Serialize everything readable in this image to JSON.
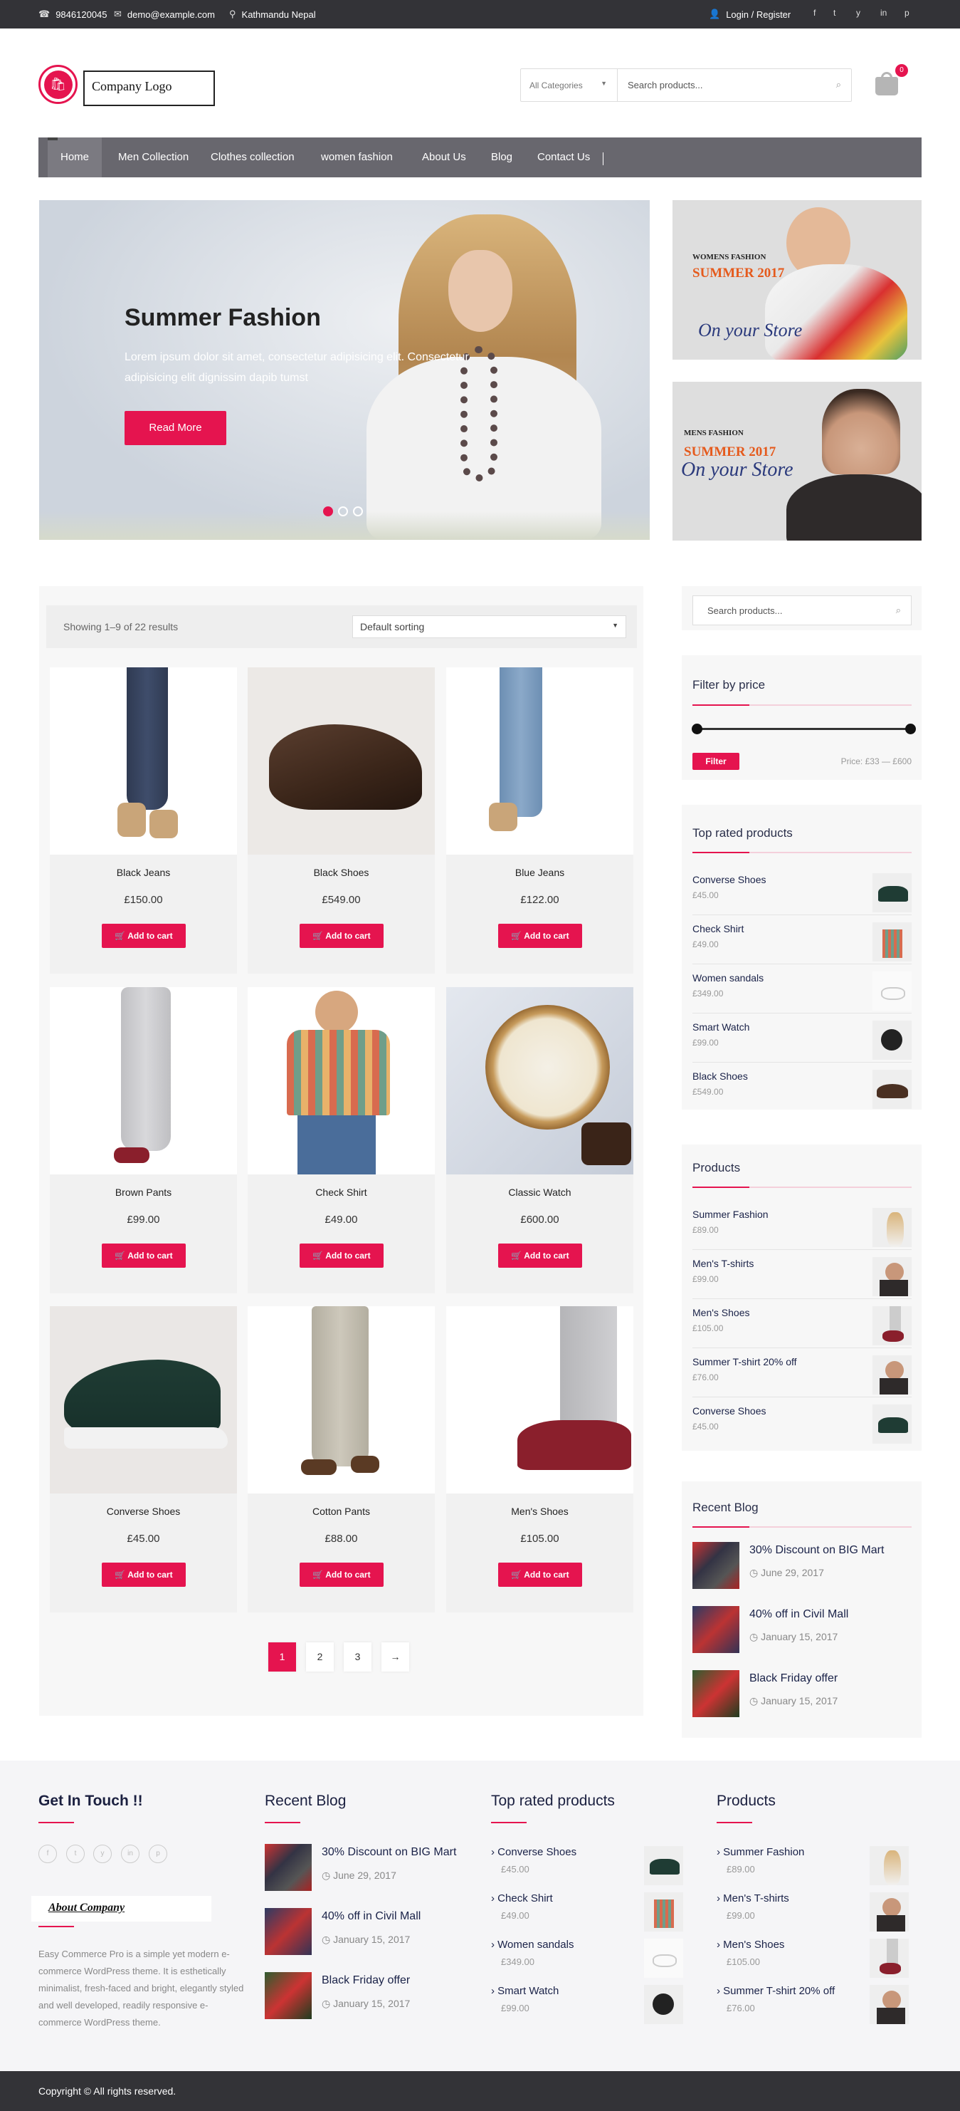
{
  "topbar": {
    "phone": "9846120045",
    "email": "demo@example.com",
    "location": "Kathmandu Nepal",
    "login": "Login / Register",
    "social": [
      "f",
      "t",
      "y",
      "in",
      "p"
    ]
  },
  "header": {
    "logo_text": "Company Logo",
    "category": "All Categories",
    "search_placeholder": "Search products...",
    "cart_count": "0"
  },
  "nav": {
    "items": [
      "Home",
      "Men Collection",
      "Clothes collection",
      "women fashion",
      "About Us",
      "Blog",
      "Contact Us"
    ]
  },
  "hero": {
    "title": "Summer Fashion",
    "text": "Lorem ipsum dolor sit amet, consectetur adipisicing elit. Consectetur adipisicing elit dignissim dapib tumst",
    "button": "Read More",
    "slides": 3,
    "active_slide": 1
  },
  "promos": [
    {
      "small": "WOMENS FASHION",
      "big": "SUMMER 2017",
      "script": "On your Store"
    },
    {
      "small": "MENS FASHION",
      "big": "SUMMER 2017",
      "script": "On your Store"
    }
  ],
  "shop": {
    "result_count": "Showing 1–9 of 22 results",
    "sorting": "Default sorting",
    "add_to_cart": "Add to cart",
    "products": [
      {
        "name": "Black Jeans",
        "price": "£150.00"
      },
      {
        "name": "Black Shoes",
        "price": "£549.00"
      },
      {
        "name": "Blue Jeans",
        "price": "£122.00"
      },
      {
        "name": "Brown Pants",
        "price": "£99.00"
      },
      {
        "name": "Check Shirt",
        "price": "£49.00"
      },
      {
        "name": "Classic Watch",
        "price": "£600.00"
      },
      {
        "name": "Converse Shoes",
        "price": "£45.00"
      },
      {
        "name": "Cotton Pants",
        "price": "£88.00"
      },
      {
        "name": "Men's Shoes",
        "price": "£105.00"
      }
    ],
    "pages": [
      "1",
      "2",
      "3",
      "→"
    ]
  },
  "sidebar": {
    "search_placeholder": "Search products...",
    "filter_title": "Filter by price",
    "filter_button": "Filter",
    "price_range": "Price: £33 — £600",
    "top_rated_title": "Top rated products",
    "top_rated": [
      {
        "name": "Converse Shoes",
        "price": "£45.00"
      },
      {
        "name": "Check Shirt",
        "price": "£49.00"
      },
      {
        "name": "Women sandals",
        "price": "£349.00"
      },
      {
        "name": "Smart Watch",
        "price": "£99.00"
      },
      {
        "name": "Black Shoes",
        "price": "£549.00"
      }
    ],
    "products_title": "Products",
    "products": [
      {
        "name": "Summer Fashion",
        "price": "£89.00"
      },
      {
        "name": "Men's T-shirts",
        "price": "£99.00"
      },
      {
        "name": "Men's Shoes",
        "price": "£105.00"
      },
      {
        "name": "Summer T-shirt 20% off",
        "price": "£76.00"
      },
      {
        "name": "Converse Shoes",
        "price": "£45.00"
      }
    ],
    "blog_title": "Recent Blog",
    "blog": [
      {
        "title": "30% Discount on BIG Mart",
        "date": "June 29, 2017"
      },
      {
        "title": "40% off in Civil Mall",
        "date": "January 15, 2017"
      },
      {
        "title": "Black Friday offer",
        "date": "January 15, 2017"
      }
    ]
  },
  "footer": {
    "contact_title": "Get In Touch !!",
    "about_logo": "About Company",
    "about_text": "Easy Commerce Pro is a simple yet modern e-commerce WordPress theme. It is esthetically minimalist, fresh-faced and bright, elegantly styled and well developed, readily responsive e-commerce WordPress theme.",
    "blog_title": "Recent Blog",
    "blog": [
      {
        "title": "30% Discount on BIG Mart",
        "date": "June 29, 2017"
      },
      {
        "title": "40% off in Civil Mall",
        "date": "January 15, 2017"
      },
      {
        "title": "Black Friday offer",
        "date": "January 15, 2017"
      }
    ],
    "top_rated_title": "Top rated products",
    "top_rated": [
      {
        "name": "Converse Shoes",
        "price": "£45.00"
      },
      {
        "name": "Check Shirt",
        "price": "£49.00"
      },
      {
        "name": "Women sandals",
        "price": "£349.00"
      },
      {
        "name": "Smart Watch",
        "price": "£99.00"
      }
    ],
    "products_title": "Products",
    "products": [
      {
        "name": "Summer Fashion",
        "price": "£89.00"
      },
      {
        "name": "Men's T-shirts",
        "price": "£99.00"
      },
      {
        "name": "Men's Shoes",
        "price": "£105.00"
      },
      {
        "name": "Summer T-shirt 20% off",
        "price": "£76.00"
      }
    ],
    "copyright": "Copyright © All rights reserved."
  },
  "colors": {
    "accent": "#e5144f",
    "nav": "#68676e",
    "topbar": "#333337"
  }
}
